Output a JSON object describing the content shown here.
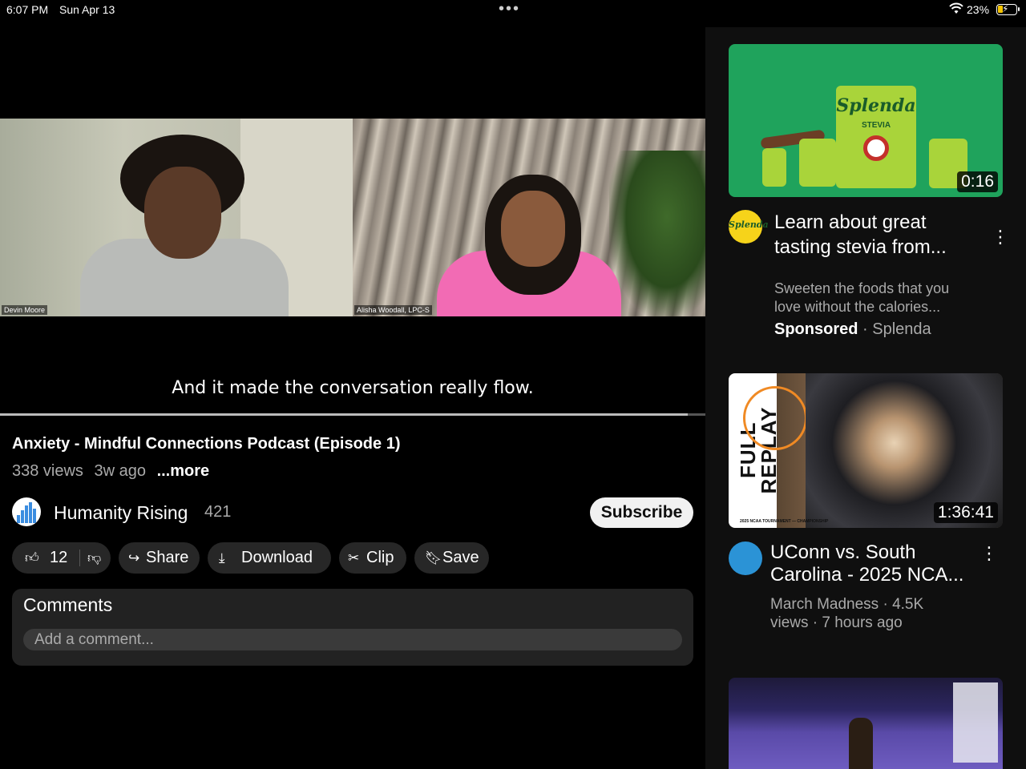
{
  "status_bar": {
    "time": "6:07 PM",
    "date": "Sun Apr 13",
    "multitask_dots": "•••",
    "battery_percent": "23%",
    "battery_level": 0.23,
    "wifi_icon": "wifi-icon",
    "battery_icon": "battery-charging-icon"
  },
  "video": {
    "participant_left": "Devin Moore",
    "participant_right": "Alisha Woodall, LPC-S",
    "caption": "And it made the conversation really flow.",
    "progress": 0.975
  },
  "info": {
    "title": "Anxiety - Mindful Connections Podcast (Episode 1)",
    "views": "338 views",
    "ago": "3w ago",
    "more": "...more"
  },
  "channel": {
    "name": "Humanity Rising",
    "subscribers": "421",
    "subscribe_label": "Subscribe"
  },
  "actions": {
    "like_count": "12",
    "share": "Share",
    "download": "Download",
    "clip": "Clip",
    "save": "Save"
  },
  "comments": {
    "heading": "Comments",
    "placeholder": "Add a comment..."
  },
  "sidebar": {
    "ad": {
      "brand_text": "Splenda",
      "product_label": "STEVIA",
      "duration": "0:16",
      "title": "Learn about great tasting stevia from...",
      "description": "Sweeten the foods that you love without the calories...",
      "sponsored": "Sponsored",
      "advertiser": "Splenda",
      "separator": "·",
      "colors": {
        "background": "#1fa35c",
        "product": "#a9d43a"
      }
    },
    "video": {
      "thumb_text_line1": "FULL",
      "thumb_text_line2": "REPLAY",
      "thumb_caption": "2025 NCAA TOURNAMENT — CHAMPIONSHIP",
      "duration": "1:36:41",
      "title": "UConn vs. South Carolina - 2025 NCA...",
      "channel": "March Madness",
      "separator": "·",
      "stats": "4.5K views · 7 hours ago"
    }
  }
}
